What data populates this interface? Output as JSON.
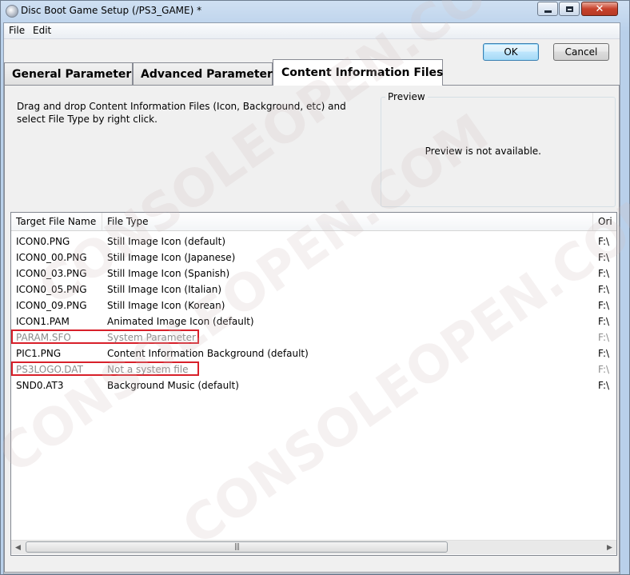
{
  "window": {
    "title": "Disc Boot Game Setup (/PS3_GAME) *",
    "icon": "disc-icon",
    "controls": {
      "minimize": "minimize-icon",
      "maximize": "maximize-icon",
      "close": "close-icon"
    }
  },
  "menu": {
    "items": [
      "File",
      "Edit"
    ]
  },
  "buttons": {
    "ok": "OK",
    "cancel": "Cancel"
  },
  "tabs": [
    {
      "label": "General Parameter",
      "active": false
    },
    {
      "label": "Advanced Parameter",
      "active": false
    },
    {
      "label": "Content Information Files",
      "active": true
    }
  ],
  "content": {
    "description": "Drag and drop Content Information Files (Icon, Background, etc) and select File Type by right click.",
    "preview": {
      "label": "Preview",
      "message": "Preview is not available."
    }
  },
  "table": {
    "columns": [
      "Target File Name",
      "File Type",
      "Ori"
    ],
    "rows": [
      {
        "name": "ICON0.PNG",
        "type": "Still Image Icon (default)",
        "origin": "F:\\",
        "dim": false,
        "highlighted": false
      },
      {
        "name": "ICON0_00.PNG",
        "type": "Still Image Icon (Japanese)",
        "origin": "F:\\",
        "dim": false,
        "highlighted": false
      },
      {
        "name": "ICON0_03.PNG",
        "type": "Still Image Icon (Spanish)",
        "origin": "F:\\",
        "dim": false,
        "highlighted": false
      },
      {
        "name": "ICON0_05.PNG",
        "type": "Still Image Icon (Italian)",
        "origin": "F:\\",
        "dim": false,
        "highlighted": false
      },
      {
        "name": "ICON0_09.PNG",
        "type": "Still Image Icon (Korean)",
        "origin": "F:\\",
        "dim": false,
        "highlighted": false
      },
      {
        "name": "ICON1.PAM",
        "type": "Animated Image Icon (default)",
        "origin": "F:\\",
        "dim": false,
        "highlighted": false
      },
      {
        "name": "PARAM.SFO",
        "type": "System Parameter",
        "origin": "F:\\",
        "dim": true,
        "highlighted": true
      },
      {
        "name": "PIC1.PNG",
        "type": "Content Information Background (default)",
        "origin": "F:\\",
        "dim": false,
        "highlighted": false
      },
      {
        "name": "PS3LOGO.DAT",
        "type": "Not a system file",
        "origin": "F:\\",
        "dim": true,
        "highlighted": true
      },
      {
        "name": "SND0.AT3",
        "type": "Background Music (default)",
        "origin": "F:\\",
        "dim": false,
        "highlighted": false
      }
    ],
    "highlight_color": "#d8202a",
    "dim_color": "#8c8c8c"
  },
  "scrollbar": {
    "left_arrow": "scroll-left-icon",
    "right_arrow": "scroll-right-icon"
  },
  "watermark": "CONSOLEOPEN.COM",
  "colors": {
    "title_bar": "#b9d0ea",
    "close_button": "#c7422c",
    "panel": "#f0f0f0"
  }
}
